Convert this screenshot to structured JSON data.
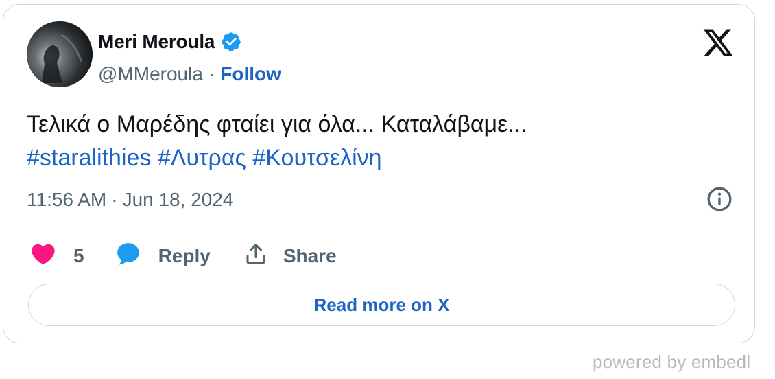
{
  "author": {
    "display_name": "Meri Meroula",
    "handle": "@MMeroula",
    "separator": "·",
    "follow_label": "Follow",
    "verified": true,
    "verified_icon": "verified-badge-icon",
    "avatar_icon": "avatar"
  },
  "brand": {
    "icon": "x-logo-icon"
  },
  "tweet": {
    "text": "Τελικά ο Μαρέδης φταίει για όλα... Καταλάβαμε...",
    "hashtags": [
      "#staralithies",
      "#Λυτρας",
      "#Κουτσελίνη"
    ],
    "time": "11:56 AM",
    "separator": "·",
    "date": "Jun 18, 2024"
  },
  "actions": {
    "like_count": "5",
    "reply_label": "Reply",
    "share_label": "Share",
    "like_icon": "heart-icon",
    "reply_icon": "speech-bubble-icon",
    "share_icon": "share-upload-icon",
    "info_icon": "info-icon"
  },
  "read_more_label": "Read more on X",
  "footer": {
    "powered_by": "powered by embedl"
  },
  "colors": {
    "link": "#1d64c4",
    "text": "#0f1419",
    "muted": "#536471",
    "heart": "#f91880",
    "reply_bubble": "#1d9bf0",
    "verified": "#1d9bf0",
    "border": "#cfd9de"
  }
}
